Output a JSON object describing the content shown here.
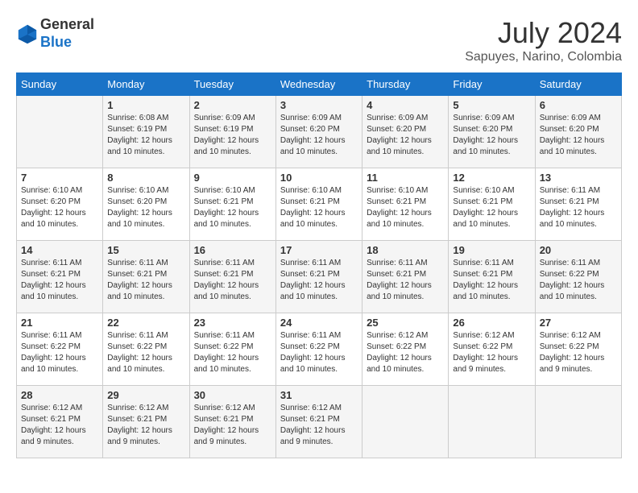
{
  "header": {
    "logo_line1": "General",
    "logo_line2": "Blue",
    "month_year": "July 2024",
    "location": "Sapuyes, Narino, Colombia"
  },
  "weekdays": [
    "Sunday",
    "Monday",
    "Tuesday",
    "Wednesday",
    "Thursday",
    "Friday",
    "Saturday"
  ],
  "weeks": [
    [
      {
        "day": "",
        "sunrise": "",
        "sunset": "",
        "daylight": ""
      },
      {
        "day": "1",
        "sunrise": "6:08 AM",
        "sunset": "6:19 PM",
        "daylight": "12 hours and 10 minutes."
      },
      {
        "day": "2",
        "sunrise": "6:09 AM",
        "sunset": "6:19 PM",
        "daylight": "12 hours and 10 minutes."
      },
      {
        "day": "3",
        "sunrise": "6:09 AM",
        "sunset": "6:20 PM",
        "daylight": "12 hours and 10 minutes."
      },
      {
        "day": "4",
        "sunrise": "6:09 AM",
        "sunset": "6:20 PM",
        "daylight": "12 hours and 10 minutes."
      },
      {
        "day": "5",
        "sunrise": "6:09 AM",
        "sunset": "6:20 PM",
        "daylight": "12 hours and 10 minutes."
      },
      {
        "day": "6",
        "sunrise": "6:09 AM",
        "sunset": "6:20 PM",
        "daylight": "12 hours and 10 minutes."
      }
    ],
    [
      {
        "day": "7",
        "sunrise": "6:10 AM",
        "sunset": "6:20 PM",
        "daylight": "12 hours and 10 minutes."
      },
      {
        "day": "8",
        "sunrise": "6:10 AM",
        "sunset": "6:20 PM",
        "daylight": "12 hours and 10 minutes."
      },
      {
        "day": "9",
        "sunrise": "6:10 AM",
        "sunset": "6:21 PM",
        "daylight": "12 hours and 10 minutes."
      },
      {
        "day": "10",
        "sunrise": "6:10 AM",
        "sunset": "6:21 PM",
        "daylight": "12 hours and 10 minutes."
      },
      {
        "day": "11",
        "sunrise": "6:10 AM",
        "sunset": "6:21 PM",
        "daylight": "12 hours and 10 minutes."
      },
      {
        "day": "12",
        "sunrise": "6:10 AM",
        "sunset": "6:21 PM",
        "daylight": "12 hours and 10 minutes."
      },
      {
        "day": "13",
        "sunrise": "6:11 AM",
        "sunset": "6:21 PM",
        "daylight": "12 hours and 10 minutes."
      }
    ],
    [
      {
        "day": "14",
        "sunrise": "6:11 AM",
        "sunset": "6:21 PM",
        "daylight": "12 hours and 10 minutes."
      },
      {
        "day": "15",
        "sunrise": "6:11 AM",
        "sunset": "6:21 PM",
        "daylight": "12 hours and 10 minutes."
      },
      {
        "day": "16",
        "sunrise": "6:11 AM",
        "sunset": "6:21 PM",
        "daylight": "12 hours and 10 minutes."
      },
      {
        "day": "17",
        "sunrise": "6:11 AM",
        "sunset": "6:21 PM",
        "daylight": "12 hours and 10 minutes."
      },
      {
        "day": "18",
        "sunrise": "6:11 AM",
        "sunset": "6:21 PM",
        "daylight": "12 hours and 10 minutes."
      },
      {
        "day": "19",
        "sunrise": "6:11 AM",
        "sunset": "6:21 PM",
        "daylight": "12 hours and 10 minutes."
      },
      {
        "day": "20",
        "sunrise": "6:11 AM",
        "sunset": "6:22 PM",
        "daylight": "12 hours and 10 minutes."
      }
    ],
    [
      {
        "day": "21",
        "sunrise": "6:11 AM",
        "sunset": "6:22 PM",
        "daylight": "12 hours and 10 minutes."
      },
      {
        "day": "22",
        "sunrise": "6:11 AM",
        "sunset": "6:22 PM",
        "daylight": "12 hours and 10 minutes."
      },
      {
        "day": "23",
        "sunrise": "6:11 AM",
        "sunset": "6:22 PM",
        "daylight": "12 hours and 10 minutes."
      },
      {
        "day": "24",
        "sunrise": "6:11 AM",
        "sunset": "6:22 PM",
        "daylight": "12 hours and 10 minutes."
      },
      {
        "day": "25",
        "sunrise": "6:12 AM",
        "sunset": "6:22 PM",
        "daylight": "12 hours and 10 minutes."
      },
      {
        "day": "26",
        "sunrise": "6:12 AM",
        "sunset": "6:22 PM",
        "daylight": "12 hours and 9 minutes."
      },
      {
        "day": "27",
        "sunrise": "6:12 AM",
        "sunset": "6:22 PM",
        "daylight": "12 hours and 9 minutes."
      }
    ],
    [
      {
        "day": "28",
        "sunrise": "6:12 AM",
        "sunset": "6:21 PM",
        "daylight": "12 hours and 9 minutes."
      },
      {
        "day": "29",
        "sunrise": "6:12 AM",
        "sunset": "6:21 PM",
        "daylight": "12 hours and 9 minutes."
      },
      {
        "day": "30",
        "sunrise": "6:12 AM",
        "sunset": "6:21 PM",
        "daylight": "12 hours and 9 minutes."
      },
      {
        "day": "31",
        "sunrise": "6:12 AM",
        "sunset": "6:21 PM",
        "daylight": "12 hours and 9 minutes."
      },
      {
        "day": "",
        "sunrise": "",
        "sunset": "",
        "daylight": ""
      },
      {
        "day": "",
        "sunrise": "",
        "sunset": "",
        "daylight": ""
      },
      {
        "day": "",
        "sunrise": "",
        "sunset": "",
        "daylight": ""
      }
    ]
  ]
}
